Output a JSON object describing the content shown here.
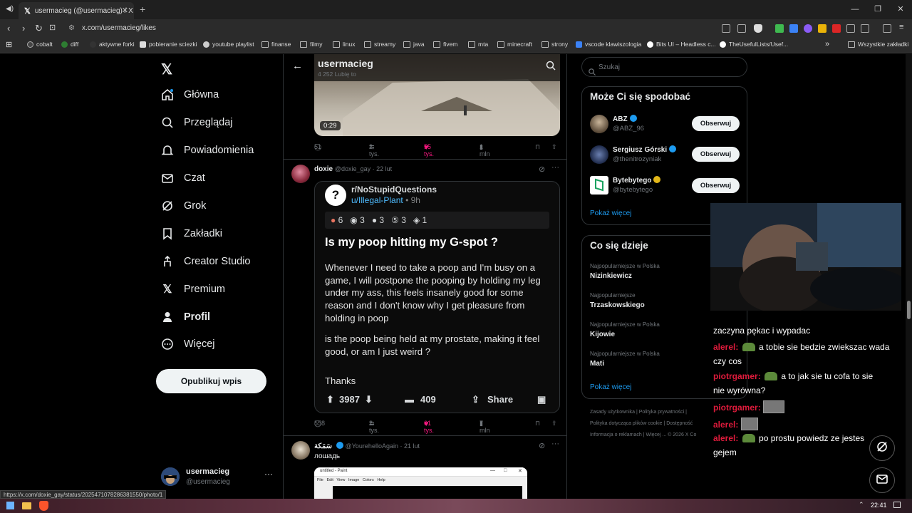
{
  "browser": {
    "tab_title": "usermacieg (@usermacieg) / X",
    "url": "x.com/usermacieg/likes",
    "status_url": "https://x.com/doxie_gay/status/2025471078286381550/photo/1",
    "bookmarks": [
      "cobalt",
      "diff",
      "aktywne forki",
      "pobieranie sciezki",
      "youtube playlist",
      "finanse",
      "filmy",
      "linux",
      "streamy",
      "java",
      "fivem",
      "mta",
      "minecraft",
      "strony",
      "vscode klawiszologia",
      "Bits UI – Headless c...",
      "TheUsefulLists/Usef..."
    ],
    "all_bookmarks": "Wszystkie zakładki"
  },
  "sidebar": {
    "items": [
      {
        "label": "Główna",
        "icon": "home-icon"
      },
      {
        "label": "Przeglądaj",
        "icon": "search-icon"
      },
      {
        "label": "Powiadomienia",
        "icon": "bell-icon"
      },
      {
        "label": "Czat",
        "icon": "mail-icon"
      },
      {
        "label": "Grok",
        "icon": "grok-icon"
      },
      {
        "label": "Zakładki",
        "icon": "bookmark-icon"
      },
      {
        "label": "Creator Studio",
        "icon": "creator-icon"
      },
      {
        "label": "Premium",
        "icon": "x-icon"
      },
      {
        "label": "Profil",
        "icon": "profile-icon"
      },
      {
        "label": "Więcej",
        "icon": "more-icon"
      }
    ],
    "publish": "Opublikuj wpis",
    "user_name": "usermacieg",
    "user_handle": "@usermacieg"
  },
  "profile_header": {
    "name": "usermacieg",
    "subtitle": "4 252 Lubię to"
  },
  "tweet1": {
    "video_time": "0:29",
    "replies": "51",
    "reposts": "2 tys.",
    "likes": "55 tys.",
    "views": "1 mln"
  },
  "tweet2": {
    "name": "doxie",
    "handle": "@doxie_gay · 22 lut",
    "reddit": {
      "sub": "r/NoStupidQuestions",
      "user": "u/Illegal-Plant",
      "age": "• 9h",
      "awards": [
        "6",
        "3",
        "3",
        "3",
        "1"
      ],
      "title": "Is my poop hitting my G-spot ?",
      "body1": "Whenever I need to take a poop and I'm busy on a game, I will postpone the pooping by holding my leg under my ass, this feels insanely good for some reason and I don't know why I get pleasure from holding in poop",
      "body2": "is the poop being held at my prostate, making it feel good, or am I just weird ?",
      "body3": "Thanks",
      "votes": "3987",
      "comments": "409",
      "share": "Share"
    },
    "replies": "558",
    "reposts": "2 tys.",
    "likes": "61 tys.",
    "views": "7 mln"
  },
  "tweet3": {
    "name": "سَمَكة",
    "handle": "@YourehelloAgain · 21 lut",
    "text": "лошадь",
    "paint_title": "untitled - Paint",
    "paint_menu": [
      "File",
      "Edit",
      "View",
      "Image",
      "Colors",
      "Help"
    ]
  },
  "right": {
    "search_placeholder": "Szukaj",
    "suggest_title": "Może Ci się spodobać",
    "suggestions": [
      {
        "name": "ABZ",
        "handle": "@ABZ_96",
        "button": "Obserwuj"
      },
      {
        "name": "Sergiusz Górski",
        "handle": "@thenitrozyniak",
        "button": "Obserwuj"
      },
      {
        "name": "Bytebytego",
        "handle": "@bytebytego",
        "button": "Obserwuj"
      }
    ],
    "show_more": "Pokaż więcej",
    "trends_title": "Co się dzieje",
    "trends": [
      {
        "cat": "Najpopularniejsze w Polska",
        "name": "Nizinkiewicz"
      },
      {
        "cat": "Najpopularniejsze",
        "name": "Trzaskowskiego"
      },
      {
        "cat": "Najpopularniejsze w Polska",
        "name": "Kijowie"
      },
      {
        "cat": "Najpopularniejsze w Polska",
        "name": "Mati"
      }
    ],
    "trends_more": "Pokaż więcej",
    "footer1": "Zasady użytkownika  |  Polityka prywatności  |",
    "footer2": "Polityka dotycząca plików cookie  |  Dostępność",
    "footer3": "Informacja o reklamach  |  Więcej ...  © 2026 X Co"
  },
  "chat": [
    {
      "user": "",
      "text": "zaczyna pękac i wypadac"
    },
    {
      "user": "alerel",
      "text": "a tobie sie bedzie zwiekszac wada"
    },
    {
      "user": "",
      "text": "czy cos"
    },
    {
      "user": "piotrgamer",
      "text": "a to jak sie tu cofa to sie"
    },
    {
      "user": "",
      "text": "nie wyrówna?"
    },
    {
      "user": "piotrgamer",
      "text": ""
    },
    {
      "user": "alerel",
      "text": ""
    },
    {
      "user": "alerel",
      "text": "po prostu powiedz ze jestes"
    },
    {
      "user": "",
      "text": "gejem"
    }
  ],
  "taskbar": {
    "time": "22:41"
  },
  "colors": {
    "like": "#f91880",
    "link": "#1d9bf0",
    "chat_user": "#e01b3c"
  }
}
